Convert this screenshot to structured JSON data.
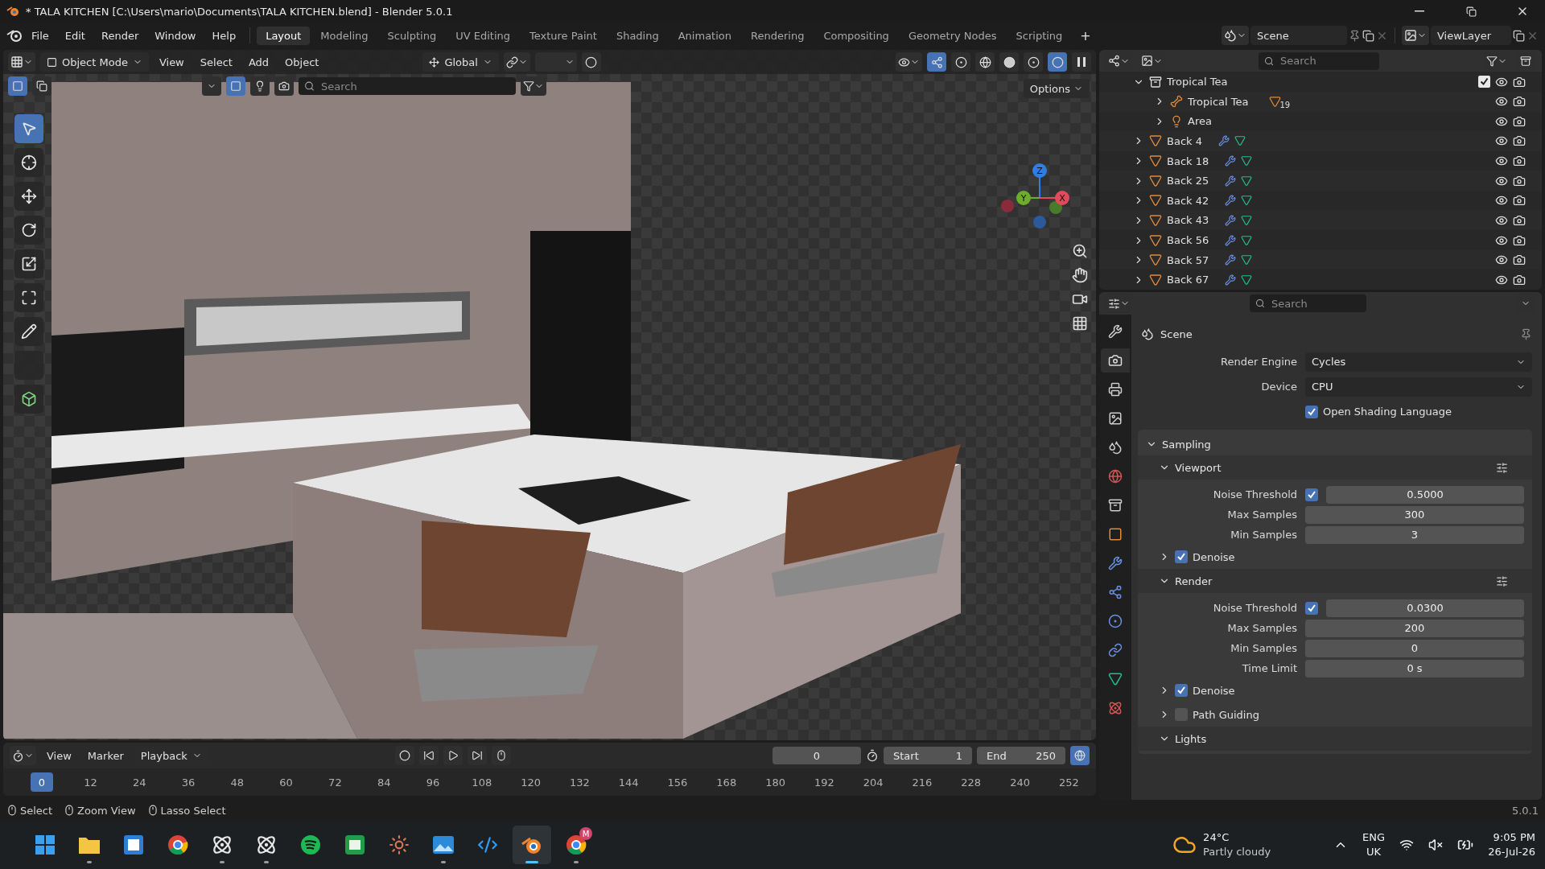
{
  "window": {
    "title": "* TALA KITCHEN [C:\\Users\\mario\\Documents\\TALA KITCHEN.blend] - Blender 5.0.1"
  },
  "menu": [
    "File",
    "Edit",
    "Render",
    "Window",
    "Help"
  ],
  "workspaces": [
    {
      "label": "Layout",
      "selected": true
    },
    {
      "label": "Modeling",
      "selected": false
    },
    {
      "label": "Sculpting",
      "selected": false
    },
    {
      "label": "UV Editing",
      "selected": false
    },
    {
      "label": "Texture Paint",
      "selected": false
    },
    {
      "label": "Shading",
      "selected": false
    },
    {
      "label": "Animation",
      "selected": false
    },
    {
      "label": "Rendering",
      "selected": false
    },
    {
      "label": "Compositing",
      "selected": false
    },
    {
      "label": "Geometry Nodes",
      "selected": false
    },
    {
      "label": "Scripting",
      "selected": false
    }
  ],
  "add_workspace": "+",
  "scene": {
    "value": "Scene"
  },
  "view_layer": {
    "value": "ViewLayer"
  },
  "viewport": {
    "mode": "Object Mode",
    "menus": [
      "View",
      "Select",
      "Add",
      "Object"
    ],
    "orientation": "Global",
    "search": {
      "placeholder": "Search"
    },
    "options": "Options",
    "gizmo_axes": [
      "Z",
      "Y",
      "X"
    ]
  },
  "tools": [
    {
      "kind": "select",
      "selected": true
    },
    {
      "kind": "cursor",
      "selected": false
    },
    {
      "kind": "move",
      "selected": false
    },
    {
      "kind": "rotate",
      "selected": false
    },
    {
      "kind": "scale",
      "selected": false
    },
    {
      "kind": "transform",
      "selected": false
    },
    {
      "kind": "annotate",
      "selected": false
    },
    {
      "kind": "measure",
      "selected": false
    },
    {
      "kind": "add",
      "selected": false
    }
  ],
  "outliner": {
    "search": {
      "placeholder": "Search"
    },
    "items": [
      {
        "name": "Tropical Tea",
        "kind": "collection",
        "expanded": true,
        "checked": true,
        "children": [
          {
            "name": "Tropical Tea",
            "kind": "armature",
            "expanded": false,
            "count": "19"
          },
          {
            "name": "Area",
            "kind": "light",
            "expanded": false
          }
        ]
      },
      {
        "name": "Back 4",
        "kind": "mesh",
        "expanded": false
      },
      {
        "name": "Back 18",
        "kind": "mesh",
        "expanded": false
      },
      {
        "name": "Back 25",
        "kind": "mesh",
        "expanded": false
      },
      {
        "name": "Back 42",
        "kind": "mesh",
        "expanded": false
      },
      {
        "name": "Back 43",
        "kind": "mesh",
        "expanded": false
      },
      {
        "name": "Back 56",
        "kind": "mesh",
        "expanded": false
      },
      {
        "name": "Back 57",
        "kind": "mesh",
        "expanded": false
      },
      {
        "name": "Back 67",
        "kind": "mesh",
        "expanded": false
      }
    ]
  },
  "properties": {
    "search": {
      "placeholder": "Search"
    },
    "tabs": [
      {
        "kind": "tool",
        "selected": false
      },
      {
        "kind": "render",
        "selected": true
      },
      {
        "kind": "output",
        "selected": false
      },
      {
        "kind": "view_layer",
        "selected": false
      },
      {
        "kind": "scene",
        "selected": false
      },
      {
        "kind": "world",
        "selected": false
      },
      {
        "kind": "collection",
        "selected": false
      },
      {
        "kind": "object",
        "selected": false
      },
      {
        "kind": "modifiers",
        "selected": false
      },
      {
        "kind": "particles",
        "selected": false
      },
      {
        "kind": "physics",
        "selected": false
      },
      {
        "kind": "constraints",
        "selected": false
      },
      {
        "kind": "data",
        "selected": false
      },
      {
        "kind": "material",
        "selected": false
      }
    ],
    "context": "Scene",
    "fields": [
      {
        "label": "Render Engine",
        "value": "Cycles"
      },
      {
        "label": "Device",
        "value": "CPU"
      }
    ],
    "osl": {
      "label": "Open Shading Language",
      "checked": true
    },
    "panel": {
      "title": "Sampling",
      "expanded": true,
      "items": [
        {
          "kind": "subheader",
          "title": "Viewport",
          "expanded": true
        },
        {
          "kind": "field",
          "label": "Noise Threshold",
          "value": "0.5000",
          "checked": true
        },
        {
          "kind": "field",
          "label": "Max Samples",
          "value": "300"
        },
        {
          "kind": "field",
          "label": "Min Samples",
          "value": "3"
        },
        {
          "kind": "toggle",
          "label": "Denoise",
          "checked": true,
          "expanded": false
        },
        {
          "kind": "subheader",
          "title": "Render",
          "expanded": true
        },
        {
          "kind": "field",
          "label": "Noise Threshold",
          "value": "0.0300",
          "checked": true
        },
        {
          "kind": "field",
          "label": "Max Samples",
          "value": "200"
        },
        {
          "kind": "field",
          "label": "Min Samples",
          "value": "0"
        },
        {
          "kind": "field",
          "label": "Time Limit",
          "value": "0 s"
        },
        {
          "kind": "toggle",
          "label": "Denoise",
          "checked": true,
          "expanded": false
        },
        {
          "kind": "toggle",
          "label": "Path Guiding",
          "checked": false,
          "expanded": false
        },
        {
          "kind": "subheader",
          "title": "Lights",
          "expanded": true
        }
      ]
    }
  },
  "timeline": {
    "menus": [
      "View",
      "Marker",
      "Playback"
    ],
    "current_frame": "0",
    "start": {
      "label": "Start",
      "value": "1"
    },
    "end": {
      "label": "End",
      "value": "250"
    },
    "playhead": "0",
    "ticks": [
      "12",
      "24",
      "36",
      "48",
      "60",
      "72",
      "84",
      "96",
      "108",
      "120",
      "132",
      "144",
      "156",
      "168",
      "180",
      "192",
      "204",
      "216",
      "228",
      "240",
      "252"
    ]
  },
  "status_bar": {
    "hints": [
      "Select",
      "Zoom View",
      "Lasso Select"
    ],
    "version": "5.0.1"
  },
  "taskbar": {
    "apps": [
      {
        "kind": "start",
        "running": false,
        "selected": false
      },
      {
        "kind": "files",
        "running": true,
        "selected": false
      },
      {
        "kind": "square",
        "running": false,
        "selected": false
      },
      {
        "kind": "browser",
        "running": false,
        "selected": false
      },
      {
        "kind": "knot",
        "running": true,
        "selected": false
      },
      {
        "kind": "knot",
        "running": true,
        "selected": false
      },
      {
        "kind": "music",
        "running": false,
        "selected": false
      },
      {
        "kind": "green",
        "running": false,
        "selected": false
      },
      {
        "kind": "star",
        "running": false,
        "selected": false
      },
      {
        "kind": "photos",
        "running": true,
        "selected": false
      },
      {
        "kind": "code",
        "running": false,
        "selected": false
      },
      {
        "kind": "blender",
        "running": true,
        "selected": true
      },
      {
        "kind": "browser",
        "running": true,
        "selected": false,
        "badge": "M"
      }
    ],
    "weather": {
      "temperature": "24°C",
      "text": "Partly cloudy"
    },
    "language": [
      "ENG",
      "UK"
    ],
    "time": "9:05 PM",
    "date": "26-Jul-26"
  }
}
